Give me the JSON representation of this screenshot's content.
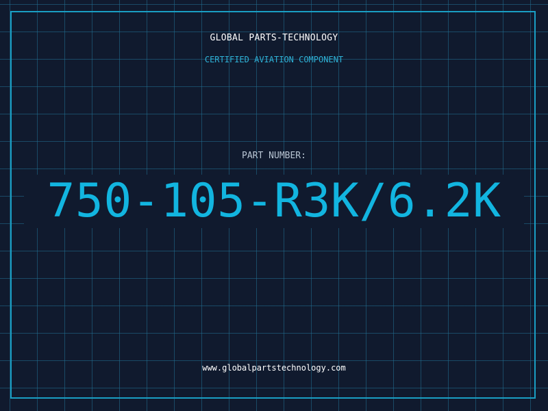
{
  "header": {
    "company": "GLOBAL PARTS-TECHNOLOGY",
    "subtitle": "CERTIFIED AVIATION COMPONENT"
  },
  "part": {
    "label": "PART NUMBER:",
    "number": "750-105-R3K/6.2K"
  },
  "footer": {
    "website": "www.globalpartstechnology.com"
  },
  "colors": {
    "background": "#101a2e",
    "grid": "#227094",
    "accent": "#12b5e0",
    "text": "#ffffff"
  }
}
